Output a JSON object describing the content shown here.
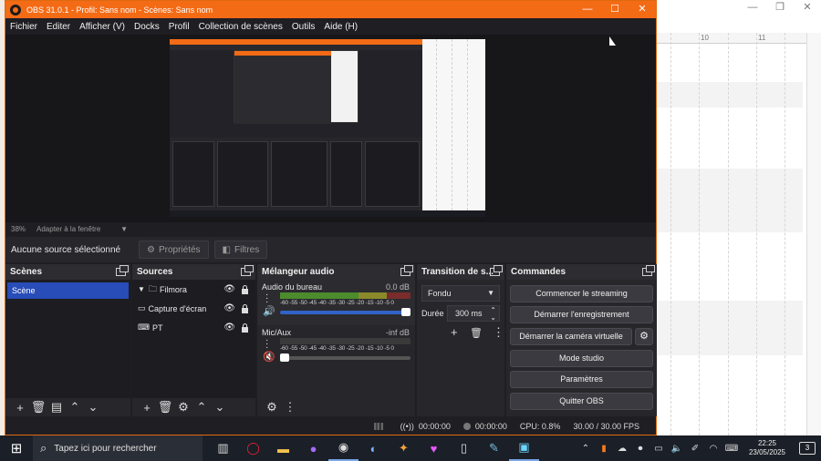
{
  "window": {
    "title": "OBS 31.0.1 - Profil: Sans nom - Scènes: Sans nom"
  },
  "menu": [
    "Fichier",
    "Editer",
    "Afficher (V)",
    "Docks",
    "Profil",
    "Collection de scènes",
    "Outils",
    "Aide (H)"
  ],
  "preview": {
    "zoom": "38%",
    "fit_mode": "Adapter à la fenêtre"
  },
  "source_toolbar": {
    "no_selection": "Aucune source sélectionné",
    "properties": "Propriétés",
    "filters": "Filtres"
  },
  "scenes": {
    "title": "Scènes",
    "items": [
      "Scène"
    ]
  },
  "sources": {
    "title": "Sources",
    "items": [
      {
        "label": "Filmora",
        "icon": "folder-icon"
      },
      {
        "label": "Capture d'écran",
        "icon": "monitor-icon"
      },
      {
        "label": "PT",
        "icon": "gamepad-icon"
      }
    ]
  },
  "mixer": {
    "title": "Mélangeur audio",
    "scale": "-60 -55 -50 -45 -40 -35 -30 -25 -20 -15 -10 -5 0",
    "channels": [
      {
        "name": "Audio du bureau",
        "db": "0.0 dB",
        "muted": false,
        "level": 1.0
      },
      {
        "name": "Mic/Aux",
        "db": "-inf dB",
        "muted": true,
        "level": 0.0
      }
    ]
  },
  "transition": {
    "title": "Transition de s...",
    "type": "Fondu",
    "duration_label": "Durée",
    "duration_value": "300 ms"
  },
  "controls": {
    "title": "Commandes",
    "start_streaming": "Commencer le streaming",
    "start_recording": "Démarrer l'enregistrement",
    "virtual_camera": "Démarrer la caméra virtuelle",
    "studio_mode": "Mode studio",
    "settings": "Paramètres",
    "quit": "Quitter OBS"
  },
  "status": {
    "stream_time": "00:00:00",
    "record_time": "00:00:00",
    "cpu": "CPU: 0.8%",
    "fps": "30.00 / 30.00 FPS"
  },
  "background_sheet": {
    "col_10": "10",
    "col_11": "11"
  },
  "taskbar": {
    "search_placeholder": "Tapez ici pour rechercher",
    "time": "22:25",
    "date": "23/05/2025",
    "notifications": "3"
  },
  "colors": {
    "obs_accent": "#f46b16",
    "scene_selected": "#284cb8",
    "fader": "#3262c8"
  }
}
